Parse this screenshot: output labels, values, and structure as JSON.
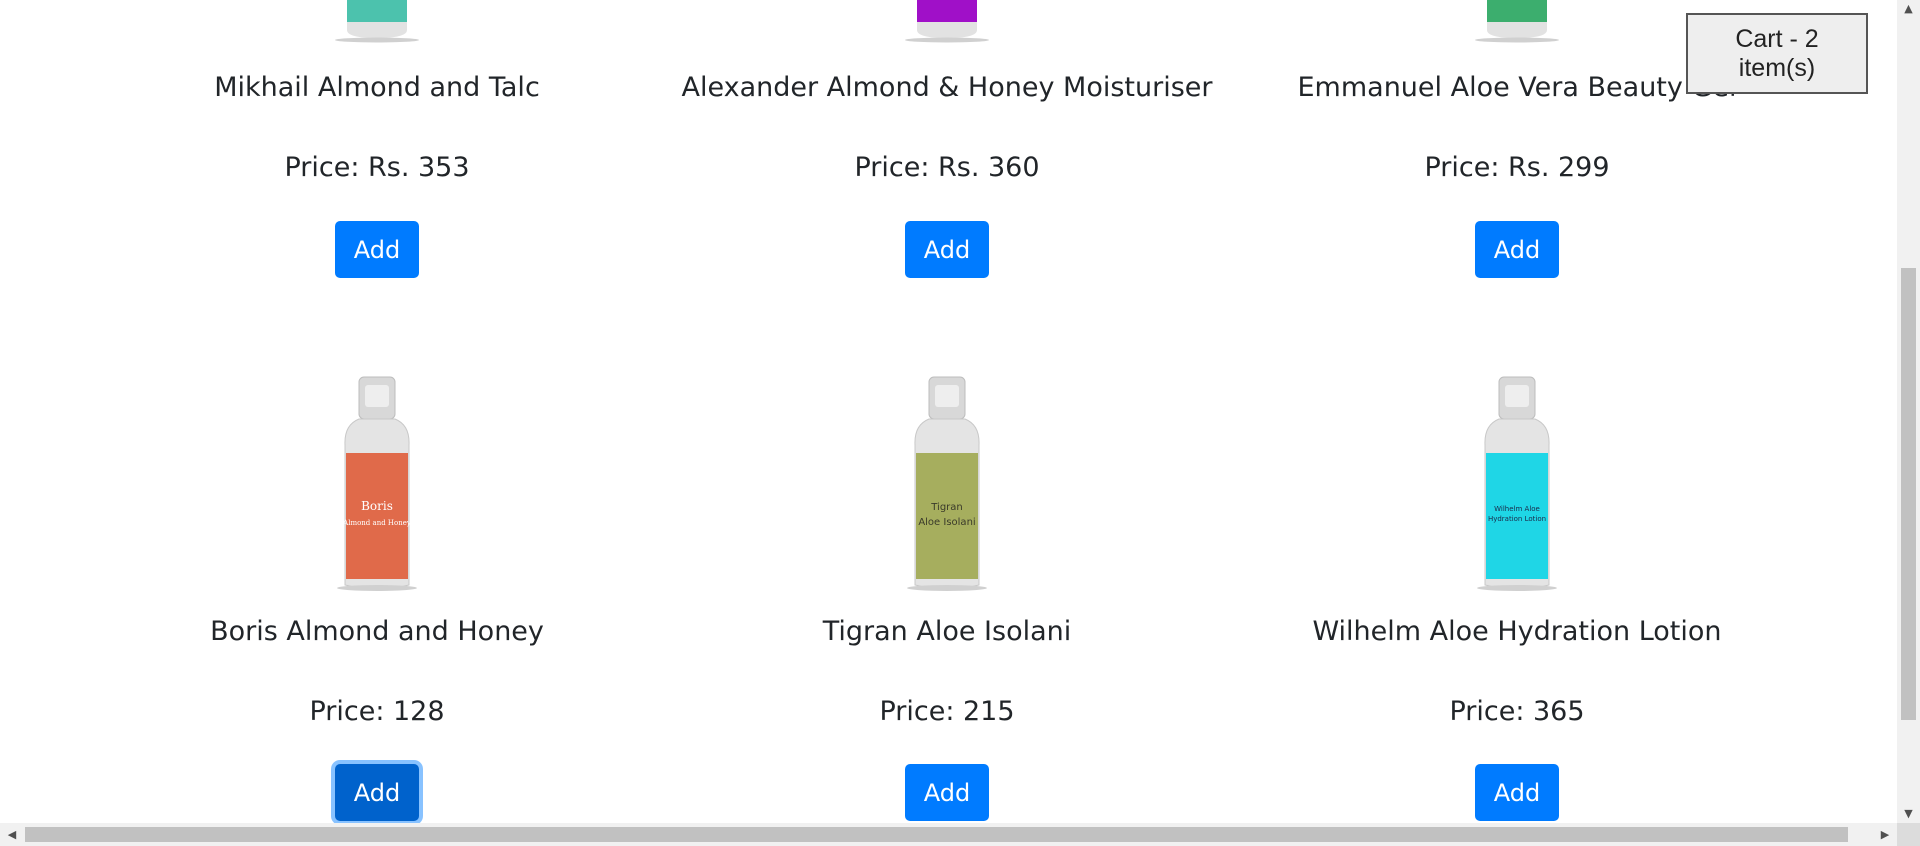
{
  "cart": {
    "label": "Cart - 2 item(s)"
  },
  "products": [
    {
      "name": "Mikhail Almond and Talc",
      "price": "Price: Rs. 353",
      "button": "Add",
      "color": "#4cc2ad"
    },
    {
      "name": "Alexander Almond & Honey Moisturiser",
      "price": "Price: Rs. 360",
      "button": "Add",
      "color": "#a010c8"
    },
    {
      "name": "Emmanuel Aloe Vera Beauty Gel",
      "price": "Price: Rs. 299",
      "button": "Add",
      "color": "#3cae6e"
    },
    {
      "name": "Boris Almond and Honey",
      "price": "Price: 128",
      "button": "Add",
      "color": "#e06a4a",
      "label_line1": "Boris",
      "label_line2": "Almond and Honey"
    },
    {
      "name": "Tigran Aloe Isolani",
      "price": "Price: 215",
      "button": "Add",
      "color": "#a6ae5e",
      "label_line1": "Tigran",
      "label_line2": "Aloe Isolani"
    },
    {
      "name": "Wilhelm Aloe Hydration Lotion",
      "price": "Price: 365",
      "button": "Add",
      "color": "#1fd6e6",
      "label_line1": "Wilhelm Aloe",
      "label_line2": "Hydration Lotion"
    }
  ],
  "theme": {
    "primary": "#007bff",
    "primary_focus": "#0062cc"
  }
}
